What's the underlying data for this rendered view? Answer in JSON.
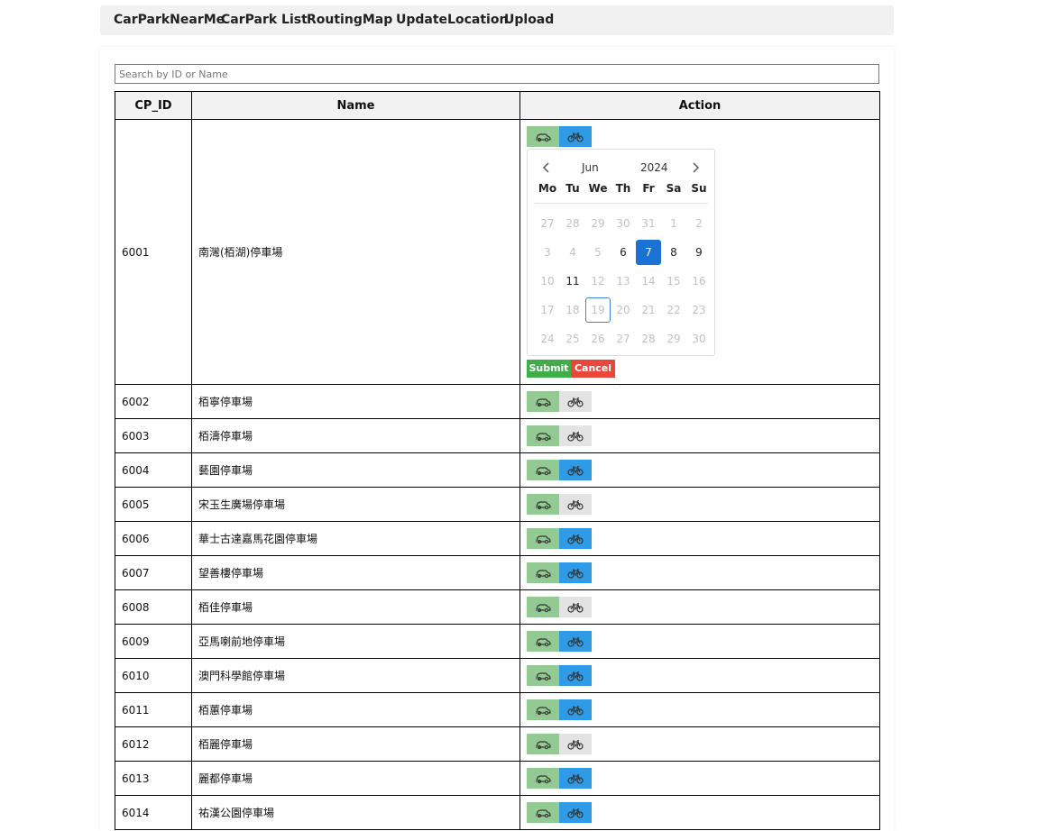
{
  "nav": [
    "CarParkNearMe",
    "CarPark List",
    "RoutingMap",
    "UpdateLocation",
    "Upload"
  ],
  "search": {
    "placeholder": "Search by ID or Name",
    "value": ""
  },
  "table": {
    "headers": [
      "CP_ID",
      "Name",
      "Action"
    ],
    "rows": [
      {
        "id": "6001",
        "name": "南灣(栢湖)停車場",
        "car": true,
        "bike": true
      },
      {
        "id": "6002",
        "name": "栢寧停車場",
        "car": true,
        "bike": false
      },
      {
        "id": "6003",
        "name": "栢濤停車場",
        "car": true,
        "bike": false
      },
      {
        "id": "6004",
        "name": "藝園停車場",
        "car": true,
        "bike": true
      },
      {
        "id": "6005",
        "name": "宋玉生廣場停車場",
        "car": true,
        "bike": false
      },
      {
        "id": "6006",
        "name": "華士古達嘉馬花園停車場",
        "car": true,
        "bike": true
      },
      {
        "id": "6007",
        "name": "望善樓停車場",
        "car": true,
        "bike": true
      },
      {
        "id": "6008",
        "name": "栢佳停車場",
        "car": true,
        "bike": false
      },
      {
        "id": "6009",
        "name": "亞馬喇前地停車場",
        "car": true,
        "bike": true
      },
      {
        "id": "6010",
        "name": "澳門科學館停車場",
        "car": true,
        "bike": true
      },
      {
        "id": "6011",
        "name": "栢蕙停車場",
        "car": true,
        "bike": true
      },
      {
        "id": "6012",
        "name": "栢麗停車場",
        "car": true,
        "bike": false
      },
      {
        "id": "6013",
        "name": "麗都停車場",
        "car": true,
        "bike": true
      },
      {
        "id": "6014",
        "name": "祐漢公園停車場",
        "car": true,
        "bike": true
      }
    ]
  },
  "calendar": {
    "month": "Jun",
    "year": "2024",
    "weekdays": [
      "Mo",
      "Tu",
      "We",
      "Th",
      "Fr",
      "Sa",
      "Su"
    ],
    "days": [
      {
        "d": "27",
        "s": "off"
      },
      {
        "d": "28",
        "s": "off"
      },
      {
        "d": "29",
        "s": "off"
      },
      {
        "d": "30",
        "s": "off"
      },
      {
        "d": "31",
        "s": "off"
      },
      {
        "d": "1",
        "s": "off"
      },
      {
        "d": "2",
        "s": "off"
      },
      {
        "d": "3",
        "s": "off"
      },
      {
        "d": "4",
        "s": "off"
      },
      {
        "d": "5",
        "s": "off"
      },
      {
        "d": "6",
        "s": "avail"
      },
      {
        "d": "7",
        "s": "selected"
      },
      {
        "d": "8",
        "s": "avail"
      },
      {
        "d": "9",
        "s": "avail"
      },
      {
        "d": "10",
        "s": "off"
      },
      {
        "d": "11",
        "s": "avail"
      },
      {
        "d": "12",
        "s": "off"
      },
      {
        "d": "13",
        "s": "off"
      },
      {
        "d": "14",
        "s": "off"
      },
      {
        "d": "15",
        "s": "off"
      },
      {
        "d": "16",
        "s": "off"
      },
      {
        "d": "17",
        "s": "off"
      },
      {
        "d": "18",
        "s": "off"
      },
      {
        "d": "19",
        "s": "today"
      },
      {
        "d": "20",
        "s": "off"
      },
      {
        "d": "21",
        "s": "off"
      },
      {
        "d": "22",
        "s": "off"
      },
      {
        "d": "23",
        "s": "off"
      },
      {
        "d": "24",
        "s": "off"
      },
      {
        "d": "25",
        "s": "off"
      },
      {
        "d": "26",
        "s": "off"
      },
      {
        "d": "27",
        "s": "off"
      },
      {
        "d": "28",
        "s": "off"
      },
      {
        "d": "29",
        "s": "off"
      },
      {
        "d": "30",
        "s": "off"
      }
    ],
    "submit": "Submit",
    "cancel": "Cancel"
  },
  "colors": {
    "car_bg": "#93c993",
    "bike_on_bg": "#2f9ae6",
    "bike_off_bg": "#e3e3e3",
    "submit": "#3fae49",
    "cancel": "#e8473a",
    "selected_day": "#1a73d4"
  },
  "icons": {
    "car": "car-icon",
    "bike": "bicycle-icon",
    "prev": "chevron-left-icon",
    "next": "chevron-right-icon"
  }
}
